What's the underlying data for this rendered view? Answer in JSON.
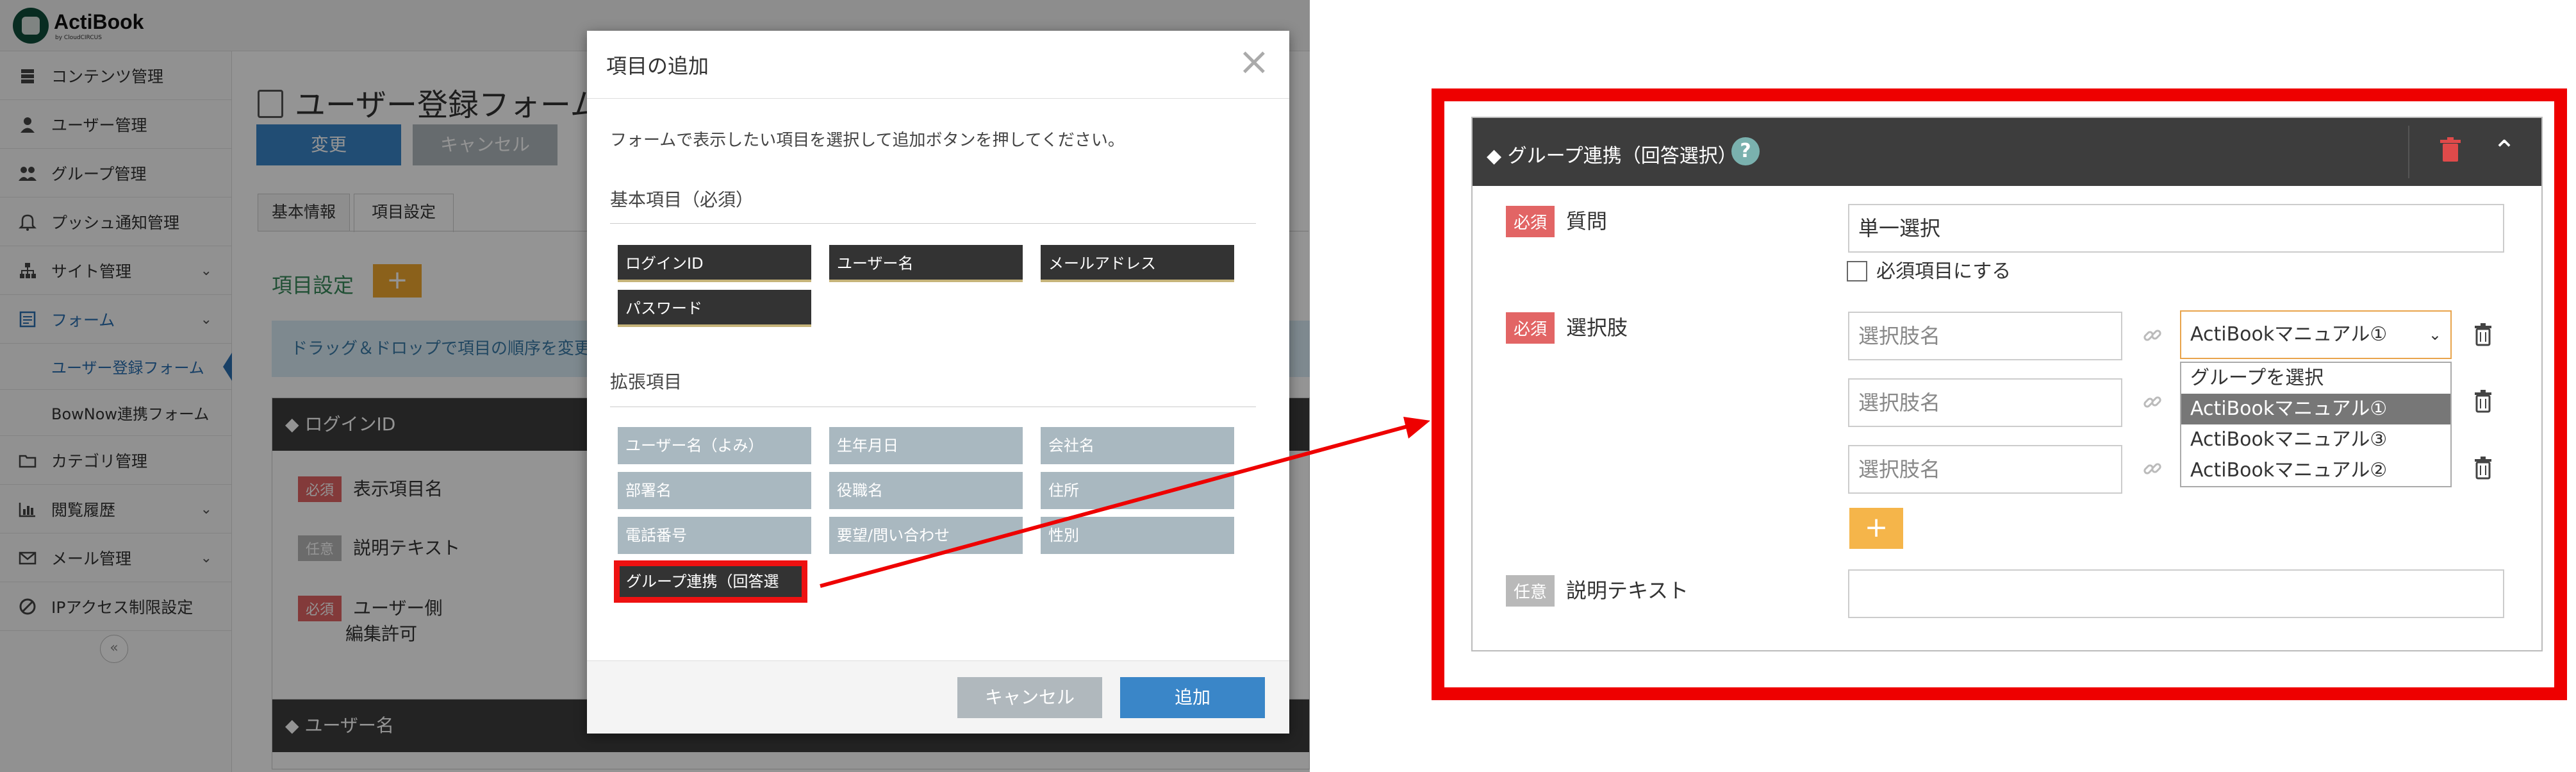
{
  "app": {
    "logo": {
      "name": "ActiBook",
      "sub": "by CloudCIRCUS"
    },
    "sidebar": {
      "items": [
        {
          "label": "コンテンツ管理",
          "icon": "layers-icon"
        },
        {
          "label": "ユーザー管理",
          "icon": "user-icon"
        },
        {
          "label": "グループ管理",
          "icon": "users-icon"
        },
        {
          "label": "プッシュ通知管理",
          "icon": "bell-icon"
        },
        {
          "label": "サイト管理",
          "icon": "sitemap-icon"
        },
        {
          "label": "フォーム",
          "icon": "form-icon"
        },
        {
          "label": "ユーザー登録フォーム"
        },
        {
          "label": "BowNow連携フォーム"
        },
        {
          "label": "カテゴリ管理",
          "icon": "folder-icon"
        },
        {
          "label": "閲覧履歴",
          "icon": "chart-icon"
        },
        {
          "label": "メール管理",
          "icon": "mail-icon"
        },
        {
          "label": "IPアクセス制限設定",
          "icon": "block-icon"
        }
      ],
      "collapse": "«"
    },
    "main": {
      "title": "ユーザー登録フォーム",
      "change_label": "変更",
      "cancel_label": "キャンセル",
      "tabs": [
        "基本情報",
        "項目設定"
      ],
      "section_title": "項目設定",
      "add_label": "+",
      "dnd_note": "ドラッグ＆ドロップで項目の順序を変更",
      "login_card": {
        "head": "ログインID",
        "rows": [
          "表示項目名",
          "説明テキスト",
          "ユーザー側",
          "編集許可"
        ]
      },
      "user_card": {
        "head": "ユーザー名"
      },
      "badge_req": "必須",
      "badge_opt": "任意"
    }
  },
  "modal": {
    "title": "項目の追加",
    "close": "×",
    "description": "フォームで表示したい項目を選択して追加ボタンを押してください。",
    "basic_title": "基本項目（必須）",
    "basic_items": [
      "ログインID",
      "ユーザー名",
      "メールアドレス",
      "パスワード"
    ],
    "ext_title": "拡張項目",
    "ext_items": [
      "ユーザー名（よみ）",
      "生年月日",
      "会社名",
      "部署名",
      "役職名",
      "住所",
      "電話番号",
      "要望/問い合わせ",
      "性別"
    ],
    "group_item": "グループ連携（回答選択）",
    "cancel_label": "キャンセル",
    "add_label": "追加"
  },
  "zoom": {
    "title": "グループ連携（回答選択）",
    "help": "?",
    "question_label": "質問",
    "question_value": "単一選択",
    "required_checkbox": "必須項目にする",
    "choices_label": "選択肢",
    "choice_placeholder": "選択肢名",
    "select_value": "ActiBookマニュアル①",
    "dropdown_options": [
      "グループを選択",
      "ActiBookマニュアル①",
      "ActiBookマニュアル③",
      "ActiBookマニュアル②"
    ],
    "add_label": "+",
    "desc_label": "説明テキスト",
    "badge_req": "必須",
    "badge_opt": "任意"
  }
}
